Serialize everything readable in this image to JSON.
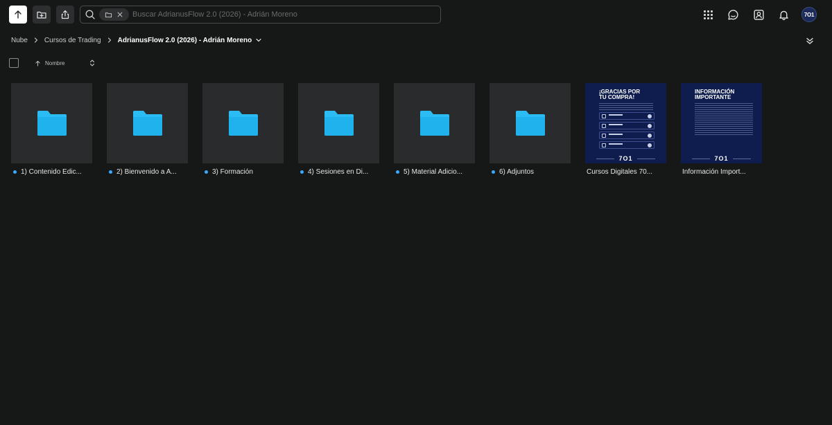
{
  "toolbar": {
    "upload_icon": "arrow-up-icon",
    "new_folder_icon": "folder-plus-icon",
    "share_icon": "share-icon"
  },
  "search": {
    "placeholder": "Buscar AdrianusFlow 2.0 (2026) - Adrián Moreno",
    "value": "",
    "scope_chip_icons": [
      "folder-icon",
      "close-icon"
    ]
  },
  "header_right": {
    "icons": [
      "apps-grid-icon",
      "chat-icon",
      "contacts-icon",
      "bell-icon"
    ],
    "avatar_text": "7O1"
  },
  "breadcrumb": {
    "items": [
      "Nube",
      "Cursos de Trading"
    ],
    "current": "AdrianusFlow 2.0 (2026) - Adrián Moreno"
  },
  "sort": {
    "label": "Nombre",
    "direction": "ascending"
  },
  "items": [
    {
      "type": "folder",
      "name": "1) Contenido Edic..."
    },
    {
      "type": "folder",
      "name": "2) Bienvenido a A..."
    },
    {
      "type": "folder",
      "name": "3) Formación"
    },
    {
      "type": "folder",
      "name": "4) Sesiones en Di..."
    },
    {
      "type": "folder",
      "name": "5) Material Adicio..."
    },
    {
      "type": "folder",
      "name": "6) Adjuntos"
    },
    {
      "type": "document",
      "name": "Cursos Digitales 70...",
      "thumb_title": "¡GRACIAS POR TU COMPRA!",
      "thumb_brand": "7O1"
    },
    {
      "type": "document",
      "name": "Información Import...",
      "thumb_title": "INFORMACIÓN IMPORTANTE",
      "thumb_brand": "7O1"
    }
  ],
  "colors": {
    "background": "#161717",
    "tile": "#2a2b2c",
    "folder": "#2bbcf3",
    "accent_dot": "#3aa8ff",
    "doc_bg": "#0e1d4d"
  }
}
